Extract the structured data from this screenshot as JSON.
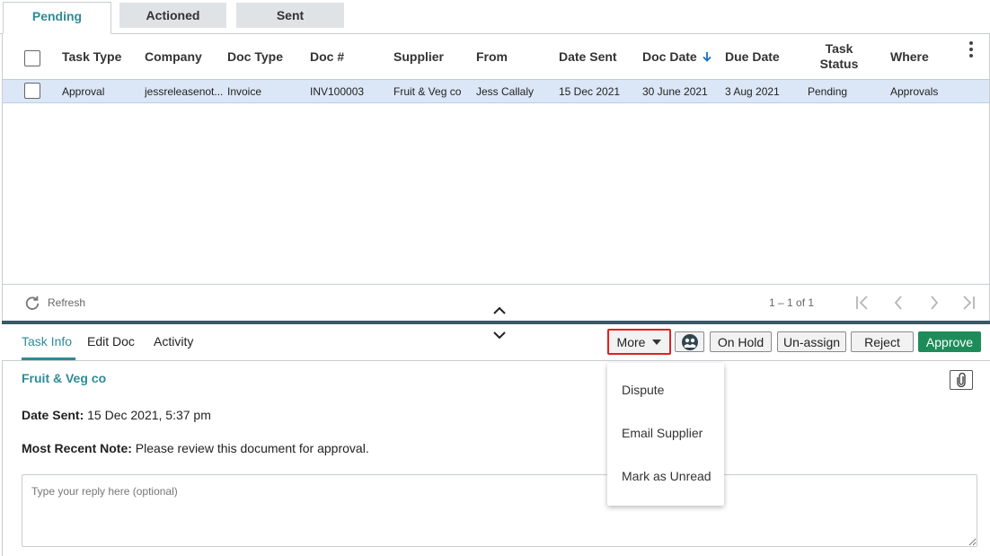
{
  "top_tabs": [
    {
      "label": "Pending",
      "active": true
    },
    {
      "label": "Actioned",
      "active": false
    },
    {
      "label": "Sent",
      "active": false
    }
  ],
  "grid": {
    "columns": [
      "Task Type",
      "Company",
      "Doc Type",
      "Doc #",
      "Supplier",
      "From",
      "Date Sent",
      "Doc Date",
      "Due Date",
      "Task Status",
      "Where"
    ],
    "task_status_line1": "Task",
    "task_status_line2": "Status",
    "sorted_column": "Doc Date",
    "rows": [
      {
        "task_type": "Approval",
        "company": "jessreleasenot...",
        "doc_type": "Invoice",
        "doc_num": "INV100003",
        "supplier": "Fruit & Veg co",
        "from": "Jess Callaly",
        "date_sent": "15 Dec 2021",
        "doc_date": "30 June 2021",
        "due_date": "3 Aug 2021",
        "task_status": "Pending",
        "where": "Approvals"
      }
    ],
    "footer": {
      "refresh_label": "Refresh",
      "pager_text": "1 – 1 of 1"
    }
  },
  "detail": {
    "tabs": [
      {
        "label": "Task Info",
        "active": true
      },
      {
        "label": "Edit Doc",
        "active": false
      },
      {
        "label": "Activity",
        "active": false
      }
    ],
    "buttons": {
      "more": "More",
      "on_hold": "On Hold",
      "unassign": "Un-assign",
      "reject": "Reject",
      "approve": "Approve"
    },
    "supplier_name": "Fruit & Veg co",
    "date_sent_label": "Date Sent:",
    "date_sent_value": "15 Dec 2021, 5:37 pm",
    "note_label": "Most Recent Note:",
    "note_value": "Please review this document for approval.",
    "reply_placeholder": "Type your reply here (optional)"
  },
  "more_menu": {
    "items": [
      "Dispute",
      "Email Supplier",
      "Mark as Unread"
    ]
  },
  "colors": {
    "accent": "#2e8b95",
    "selected_row": "#dbe7f7",
    "approve": "#1e8c5a",
    "splitter": "#3a5866",
    "highlight_border": "#e02020"
  }
}
